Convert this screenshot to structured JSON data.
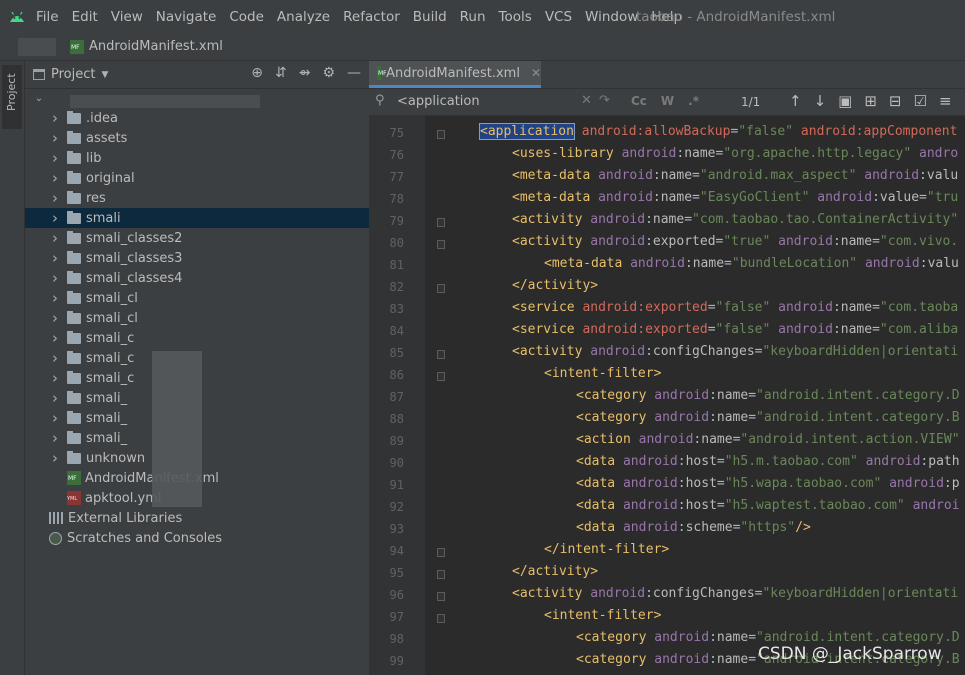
{
  "menubar": {
    "items": [
      "File",
      "Edit",
      "View",
      "Navigate",
      "Code",
      "Analyze",
      "Refactor",
      "Build",
      "Run",
      "Tools",
      "VCS",
      "Window",
      "Help"
    ],
    "window_title": "taobao - AndroidManifest.xml"
  },
  "navbar": {
    "crumb": "AndroidManifest.xml"
  },
  "left_strip": {
    "tab_label": "Project"
  },
  "project_panel": {
    "title": "Project",
    "tree": [
      {
        "label": ".idea",
        "type": "folder"
      },
      {
        "label": "assets",
        "type": "folder"
      },
      {
        "label": "lib",
        "type": "folder"
      },
      {
        "label": "original",
        "type": "folder"
      },
      {
        "label": "res",
        "type": "folder"
      },
      {
        "label": "smali",
        "type": "folder",
        "selected": true
      },
      {
        "label": "smali_classes2",
        "type": "folder"
      },
      {
        "label": "smali_classes3",
        "type": "folder"
      },
      {
        "label": "smali_classes4",
        "type": "folder"
      },
      {
        "label": "smali_cl",
        "type": "folder"
      },
      {
        "label": "smali_cl",
        "type": "folder"
      },
      {
        "label": "smali_c",
        "type": "folder"
      },
      {
        "label": "smali_c",
        "type": "folder"
      },
      {
        "label": "smali_c",
        "type": "folder"
      },
      {
        "label": "smali_",
        "type": "folder"
      },
      {
        "label": "smali_",
        "type": "folder"
      },
      {
        "label": "smali_",
        "type": "folder"
      },
      {
        "label": "unknown",
        "type": "folder"
      },
      {
        "label": "AndroidManifest.xml",
        "type": "manifest"
      },
      {
        "label": "apktool.yml",
        "type": "yml"
      },
      {
        "label": "External Libraries",
        "type": "lib"
      },
      {
        "label": "Scratches and Consoles",
        "type": "scratch"
      }
    ]
  },
  "editor": {
    "tab_label": "AndroidManifest.xml",
    "search": {
      "query": "<application",
      "match_case": "Cc",
      "words": "W",
      "regex": ".*",
      "count": "1/1"
    },
    "lines": [
      {
        "n": "75",
        "indent": 0,
        "tokens": [
          [
            "hl",
            "<application"
          ],
          [
            "sp",
            " "
          ],
          [
            "atb",
            "android:allowBackup"
          ],
          [
            "tx",
            "="
          ],
          [
            "vl",
            "\"false\""
          ],
          [
            "sp",
            " "
          ],
          [
            "atb",
            "android:appComponent"
          ]
        ]
      },
      {
        "n": "76",
        "indent": 1,
        "tokens": [
          [
            "tg",
            "<uses-library"
          ],
          [
            "sp",
            " "
          ],
          [
            "ns",
            "android"
          ],
          [
            "tx",
            ":"
          ],
          [
            "at",
            "name"
          ],
          [
            "tx",
            "="
          ],
          [
            "vl",
            "\"org.apache.http.legacy\""
          ],
          [
            "sp",
            " "
          ],
          [
            "ns",
            "andro"
          ]
        ]
      },
      {
        "n": "77",
        "indent": 1,
        "tokens": [
          [
            "tg",
            "<meta-data"
          ],
          [
            "sp",
            " "
          ],
          [
            "ns",
            "android"
          ],
          [
            "tx",
            ":"
          ],
          [
            "at",
            "name"
          ],
          [
            "tx",
            "="
          ],
          [
            "vl",
            "\"android.max_aspect\""
          ],
          [
            "sp",
            " "
          ],
          [
            "ns",
            "android"
          ],
          [
            "tx",
            ":"
          ],
          [
            "at",
            "valu"
          ]
        ]
      },
      {
        "n": "78",
        "indent": 1,
        "tokens": [
          [
            "tg",
            "<meta-data"
          ],
          [
            "sp",
            " "
          ],
          [
            "ns",
            "android"
          ],
          [
            "tx",
            ":"
          ],
          [
            "at",
            "name"
          ],
          [
            "tx",
            "="
          ],
          [
            "vl",
            "\"EasyGoClient\""
          ],
          [
            "sp",
            " "
          ],
          [
            "ns",
            "android"
          ],
          [
            "tx",
            ":"
          ],
          [
            "at",
            "value"
          ],
          [
            "tx",
            "="
          ],
          [
            "vl",
            "\"tru"
          ]
        ]
      },
      {
        "n": "79",
        "indent": 1,
        "tokens": [
          [
            "tg",
            "<activity"
          ],
          [
            "sp",
            " "
          ],
          [
            "ns",
            "android"
          ],
          [
            "tx",
            ":"
          ],
          [
            "at",
            "name"
          ],
          [
            "tx",
            "="
          ],
          [
            "vl",
            "\"com.taobao.tao.ContainerActivity\""
          ]
        ]
      },
      {
        "n": "80",
        "indent": 1,
        "tokens": [
          [
            "tg",
            "<activity"
          ],
          [
            "sp",
            " "
          ],
          [
            "ns",
            "android"
          ],
          [
            "tx",
            ":"
          ],
          [
            "at",
            "exported"
          ],
          [
            "tx",
            "="
          ],
          [
            "vl",
            "\"true\""
          ],
          [
            "sp",
            " "
          ],
          [
            "ns",
            "android"
          ],
          [
            "tx",
            ":"
          ],
          [
            "at",
            "name"
          ],
          [
            "tx",
            "="
          ],
          [
            "vl",
            "\"com.vivo."
          ]
        ]
      },
      {
        "n": "81",
        "indent": 2,
        "tokens": [
          [
            "tg",
            "<meta-data"
          ],
          [
            "sp",
            " "
          ],
          [
            "ns",
            "android"
          ],
          [
            "tx",
            ":"
          ],
          [
            "at",
            "name"
          ],
          [
            "tx",
            "="
          ],
          [
            "vl",
            "\"bundleLocation\""
          ],
          [
            "sp",
            " "
          ],
          [
            "ns",
            "android"
          ],
          [
            "tx",
            ":"
          ],
          [
            "at",
            "valu"
          ]
        ]
      },
      {
        "n": "82",
        "indent": 1,
        "tokens": [
          [
            "tg",
            "</activity>"
          ]
        ]
      },
      {
        "n": "83",
        "indent": 1,
        "tokens": [
          [
            "tg",
            "<service"
          ],
          [
            "sp",
            " "
          ],
          [
            "atb",
            "android:exported"
          ],
          [
            "tx",
            "="
          ],
          [
            "vl",
            "\"false\""
          ],
          [
            "sp",
            " "
          ],
          [
            "ns",
            "android"
          ],
          [
            "tx",
            ":"
          ],
          [
            "at",
            "name"
          ],
          [
            "tx",
            "="
          ],
          [
            "vl",
            "\"com.taoba"
          ]
        ]
      },
      {
        "n": "84",
        "indent": 1,
        "tokens": [
          [
            "tg",
            "<service"
          ],
          [
            "sp",
            " "
          ],
          [
            "atb",
            "android:exported"
          ],
          [
            "tx",
            "="
          ],
          [
            "vl",
            "\"false\""
          ],
          [
            "sp",
            " "
          ],
          [
            "ns",
            "android"
          ],
          [
            "tx",
            ":"
          ],
          [
            "at",
            "name"
          ],
          [
            "tx",
            "="
          ],
          [
            "vl",
            "\"com.aliba"
          ]
        ]
      },
      {
        "n": "85",
        "indent": 1,
        "tokens": [
          [
            "tg",
            "<activity"
          ],
          [
            "sp",
            " "
          ],
          [
            "ns",
            "android"
          ],
          [
            "tx",
            ":"
          ],
          [
            "at",
            "configChanges"
          ],
          [
            "tx",
            "="
          ],
          [
            "vl",
            "\"keyboardHidden|orientati"
          ]
        ]
      },
      {
        "n": "86",
        "indent": 2,
        "tokens": [
          [
            "tg",
            "<intent-filter>"
          ]
        ]
      },
      {
        "n": "87",
        "indent": 3,
        "tokens": [
          [
            "tg",
            "<category"
          ],
          [
            "sp",
            " "
          ],
          [
            "ns",
            "android"
          ],
          [
            "tx",
            ":"
          ],
          [
            "at",
            "name"
          ],
          [
            "tx",
            "="
          ],
          [
            "vl",
            "\"android.intent.category.D"
          ]
        ]
      },
      {
        "n": "88",
        "indent": 3,
        "tokens": [
          [
            "tg",
            "<category"
          ],
          [
            "sp",
            " "
          ],
          [
            "ns",
            "android"
          ],
          [
            "tx",
            ":"
          ],
          [
            "at",
            "name"
          ],
          [
            "tx",
            "="
          ],
          [
            "vl",
            "\"android.intent.category.B"
          ]
        ]
      },
      {
        "n": "89",
        "indent": 3,
        "tokens": [
          [
            "tg",
            "<action"
          ],
          [
            "sp",
            " "
          ],
          [
            "ns",
            "android"
          ],
          [
            "tx",
            ":"
          ],
          [
            "at",
            "name"
          ],
          [
            "tx",
            "="
          ],
          [
            "vl",
            "\"android.intent.action.VIEW\""
          ]
        ]
      },
      {
        "n": "90",
        "indent": 3,
        "tokens": [
          [
            "tg",
            "<data"
          ],
          [
            "sp",
            " "
          ],
          [
            "ns",
            "android"
          ],
          [
            "tx",
            ":"
          ],
          [
            "at",
            "host"
          ],
          [
            "tx",
            "="
          ],
          [
            "vl",
            "\"h5.m.taobao.com\""
          ],
          [
            "sp",
            " "
          ],
          [
            "ns",
            "android"
          ],
          [
            "tx",
            ":"
          ],
          [
            "at",
            "path"
          ]
        ]
      },
      {
        "n": "91",
        "indent": 3,
        "tokens": [
          [
            "tg",
            "<data"
          ],
          [
            "sp",
            " "
          ],
          [
            "ns",
            "android"
          ],
          [
            "tx",
            ":"
          ],
          [
            "at",
            "host"
          ],
          [
            "tx",
            "="
          ],
          [
            "vl",
            "\"h5.wapa.taobao.com\""
          ],
          [
            "sp",
            " "
          ],
          [
            "ns",
            "android"
          ],
          [
            "tx",
            ":"
          ],
          [
            "at",
            "p"
          ]
        ]
      },
      {
        "n": "92",
        "indent": 3,
        "tokens": [
          [
            "tg",
            "<data"
          ],
          [
            "sp",
            " "
          ],
          [
            "ns",
            "android"
          ],
          [
            "tx",
            ":"
          ],
          [
            "at",
            "host"
          ],
          [
            "tx",
            "="
          ],
          [
            "vl",
            "\"h5.waptest.taobao.com\""
          ],
          [
            "sp",
            " "
          ],
          [
            "ns",
            "androi"
          ]
        ]
      },
      {
        "n": "93",
        "indent": 3,
        "tokens": [
          [
            "tg",
            "<data"
          ],
          [
            "sp",
            " "
          ],
          [
            "ns",
            "android"
          ],
          [
            "tx",
            ":"
          ],
          [
            "at",
            "scheme"
          ],
          [
            "tx",
            "="
          ],
          [
            "vl",
            "\"https\""
          ],
          [
            "tg",
            "/>"
          ]
        ]
      },
      {
        "n": "94",
        "indent": 2,
        "tokens": [
          [
            "tg",
            "</intent-filter>"
          ]
        ]
      },
      {
        "n": "95",
        "indent": 1,
        "tokens": [
          [
            "tg",
            "</activity>"
          ]
        ]
      },
      {
        "n": "96",
        "indent": 1,
        "tokens": [
          [
            "tg",
            "<activity"
          ],
          [
            "sp",
            " "
          ],
          [
            "ns",
            "android"
          ],
          [
            "tx",
            ":"
          ],
          [
            "at",
            "configChanges"
          ],
          [
            "tx",
            "="
          ],
          [
            "vl",
            "\"keyboardHidden|orientati"
          ]
        ]
      },
      {
        "n": "97",
        "indent": 2,
        "tokens": [
          [
            "tg",
            "<intent-filter>"
          ]
        ]
      },
      {
        "n": "98",
        "indent": 3,
        "tokens": [
          [
            "tg",
            "<category"
          ],
          [
            "sp",
            " "
          ],
          [
            "ns",
            "android"
          ],
          [
            "tx",
            ":"
          ],
          [
            "at",
            "name"
          ],
          [
            "tx",
            "="
          ],
          [
            "vl",
            "\"android.intent.category.D"
          ]
        ]
      },
      {
        "n": "99",
        "indent": 3,
        "tokens": [
          [
            "tg",
            "<category"
          ],
          [
            "sp",
            " "
          ],
          [
            "ns",
            "android"
          ],
          [
            "tx",
            ":"
          ],
          [
            "at",
            "name"
          ],
          [
            "tx",
            "="
          ],
          [
            "vl",
            "\"android.intent.category.B"
          ]
        ]
      }
    ]
  },
  "watermark": "CSDN @_JackSparrow",
  "colors": {
    "tag": "#e8bf6a",
    "namespace": "#9876aa",
    "value": "#6a8759",
    "selection": "#0d293e",
    "tab_underline": "#4a88c7"
  }
}
